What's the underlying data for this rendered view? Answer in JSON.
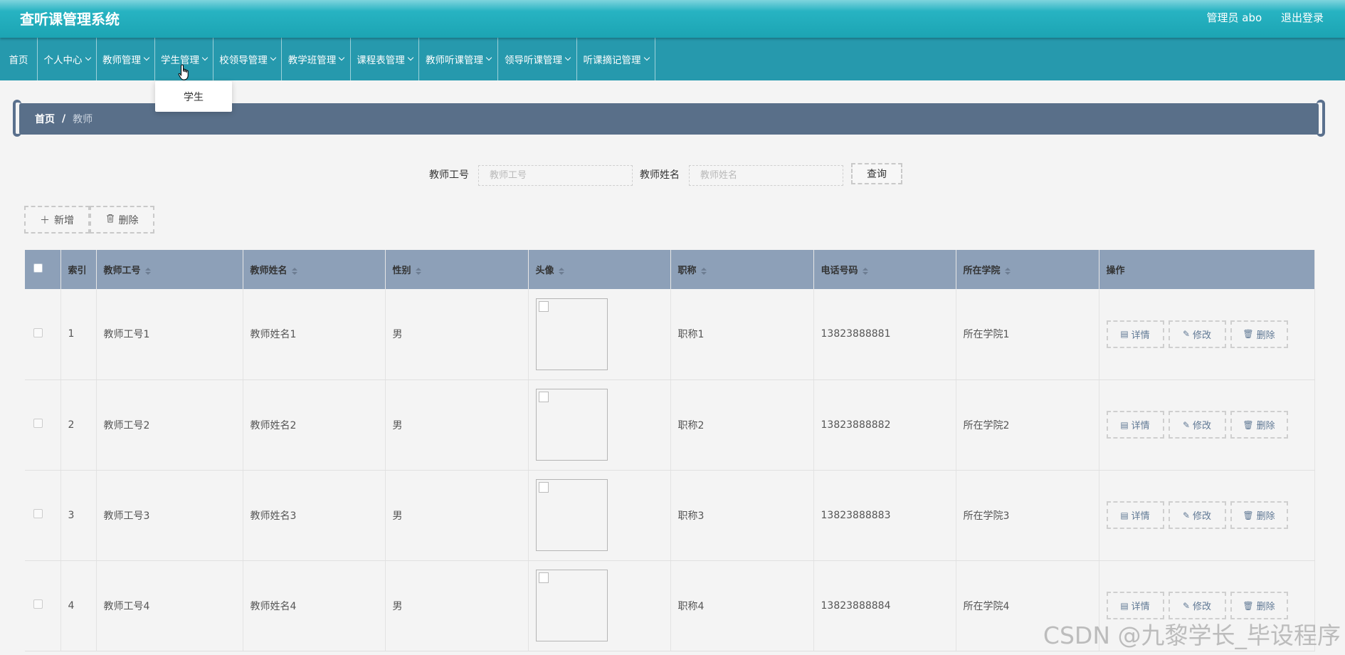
{
  "header": {
    "title": "查听课管理系统",
    "user_label": "管理员 abo",
    "logout_label": "退出登录"
  },
  "nav": {
    "items": [
      {
        "label": "首页"
      },
      {
        "label": "个人中心"
      },
      {
        "label": "教师管理"
      },
      {
        "label": "学生管理"
      },
      {
        "label": "校领导管理"
      },
      {
        "label": "教学班管理"
      },
      {
        "label": "课程表管理"
      },
      {
        "label": "教师听课管理"
      },
      {
        "label": "领导听课管理"
      },
      {
        "label": "听课摘记管理"
      }
    ],
    "dropdown_item": "学生"
  },
  "breadcrumb": {
    "home": "首页",
    "separator": "/",
    "current": "教师"
  },
  "search": {
    "teacher_id_label": "教师工号",
    "teacher_id_placeholder": "教师工号",
    "teacher_name_label": "教师姓名",
    "teacher_name_placeholder": "教师姓名",
    "query_label": "查询"
  },
  "actions": {
    "add_label": "新增",
    "delete_label": "删除"
  },
  "table": {
    "headers": {
      "index": "索引",
      "teacher_id": "教师工号",
      "teacher_name": "教师姓名",
      "gender": "性别",
      "avatar": "头像",
      "title": "职称",
      "phone": "电话号码",
      "college": "所在学院",
      "ops": "操作"
    },
    "op_labels": {
      "detail": "详情",
      "edit": "修改",
      "delete": "删除"
    },
    "rows": [
      {
        "index": "1",
        "teacher_id": "教师工号1",
        "teacher_name": "教师姓名1",
        "gender": "男",
        "title": "职称1",
        "phone": "13823888881",
        "college": "所在学院1"
      },
      {
        "index": "2",
        "teacher_id": "教师工号2",
        "teacher_name": "教师姓名2",
        "gender": "男",
        "title": "职称2",
        "phone": "13823888882",
        "college": "所在学院2"
      },
      {
        "index": "3",
        "teacher_id": "教师工号3",
        "teacher_name": "教师姓名3",
        "gender": "男",
        "title": "职称3",
        "phone": "13823888883",
        "college": "所在学院3"
      },
      {
        "index": "4",
        "teacher_id": "教师工号4",
        "teacher_name": "教师姓名4",
        "gender": "男",
        "title": "职称4",
        "phone": "13823888884",
        "college": "所在学院4"
      }
    ]
  },
  "watermark": "CSDN @九黎学长_毕设程序",
  "colors": {
    "header": "#1ca4b3",
    "nav": "#2699ad",
    "breadcrumb": "#596f89",
    "table_header": "#8da0b8"
  }
}
